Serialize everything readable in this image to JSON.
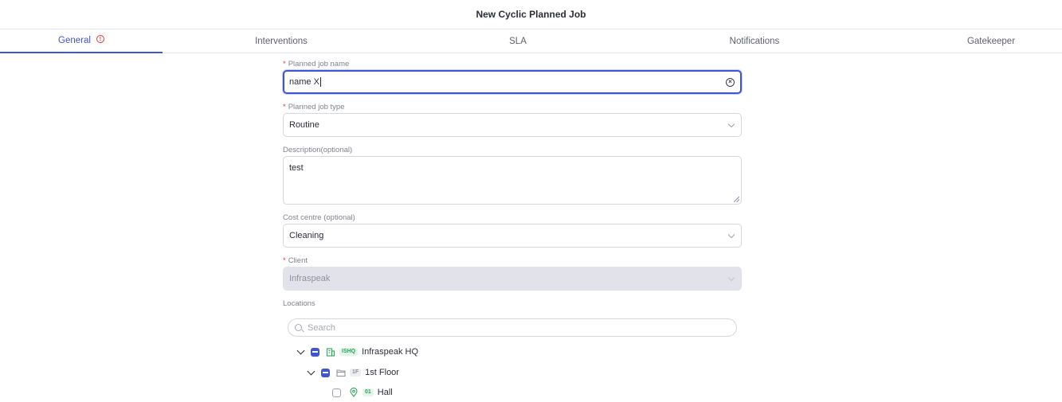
{
  "header": {
    "title": "New Cyclic Planned Job"
  },
  "tabs": [
    {
      "label": "General",
      "active": true,
      "warning": "!"
    },
    {
      "label": "Interventions"
    },
    {
      "label": "SLA"
    },
    {
      "label": "Notifications"
    },
    {
      "label": "Gatekeeper"
    }
  ],
  "form": {
    "name": {
      "required_mark": "*",
      "label": "Planned job name",
      "value": "name X"
    },
    "type": {
      "required_mark": "*",
      "label": "Planned job type",
      "value": "Routine"
    },
    "description": {
      "label": "Description",
      "optional": "(optional)",
      "value": "test"
    },
    "cost_centre": {
      "label": "Cost centre",
      "optional": "(optional)",
      "value": "Cleaning"
    },
    "client": {
      "required_mark": "*",
      "label": "Client",
      "value": "Infraspeak"
    },
    "locations": {
      "label": "Locations",
      "search_placeholder": "Search",
      "tree": [
        {
          "code": "ISHQ",
          "name": "Infraspeak HQ",
          "state": "partial",
          "expanded": true,
          "icon": "building-icon"
        },
        {
          "code": "1F",
          "name": "1st Floor",
          "state": "partial",
          "expanded": true,
          "icon": "folder-icon"
        },
        {
          "code": "01",
          "name": "Hall",
          "state": "unchecked",
          "icon": "location-pin-icon"
        }
      ]
    }
  },
  "colors": {
    "accent": "#3e55d4",
    "required": "#e03a3a",
    "badge_green": "#2aa656"
  }
}
